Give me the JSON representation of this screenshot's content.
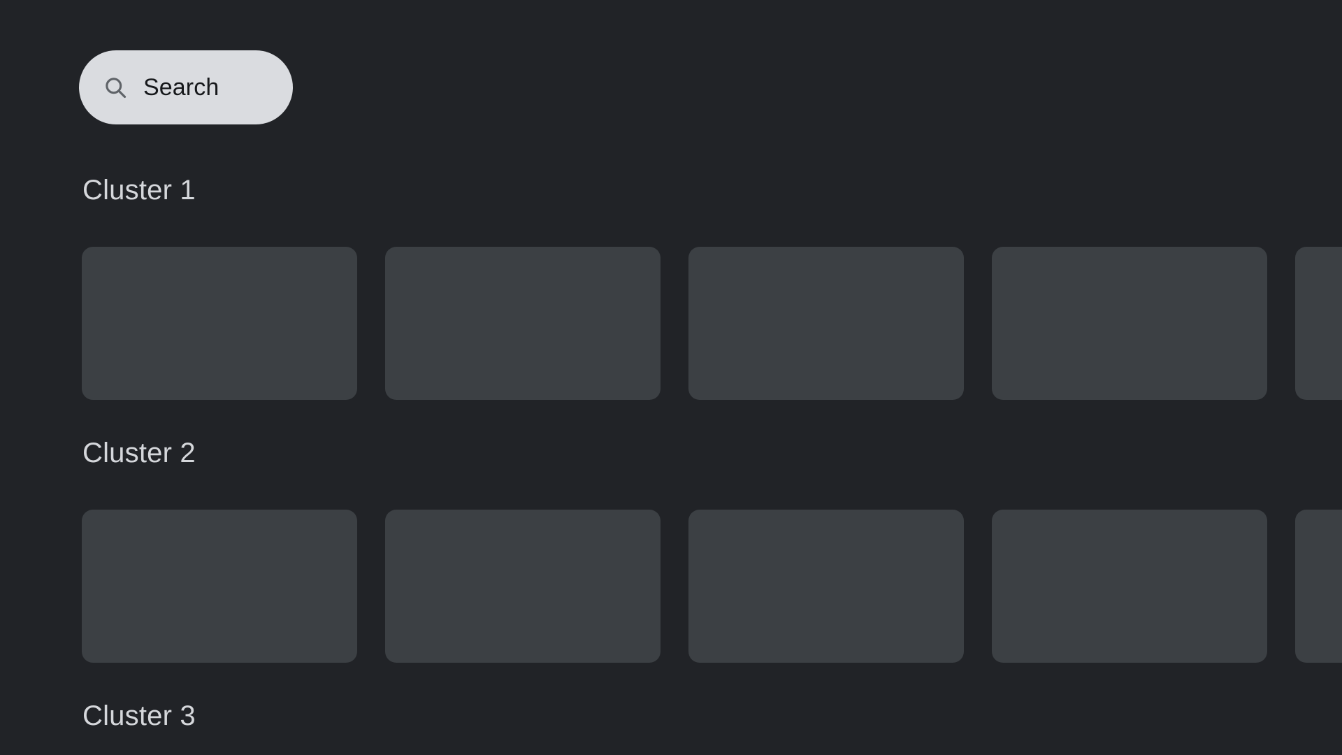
{
  "theme": {
    "background": "#212327",
    "card_color": "#3c4044",
    "title_color": "#d5d7db",
    "search_pill_color": "#dadce0",
    "search_text_color": "#16181b",
    "search_icon_color": "#5f6368"
  },
  "search": {
    "label": "Search",
    "icon": "search-icon"
  },
  "clusters": [
    {
      "title": "Cluster 1",
      "card_count": 5
    },
    {
      "title": "Cluster 2",
      "card_count": 5
    },
    {
      "title": "Cluster 3",
      "card_count": 0
    }
  ]
}
